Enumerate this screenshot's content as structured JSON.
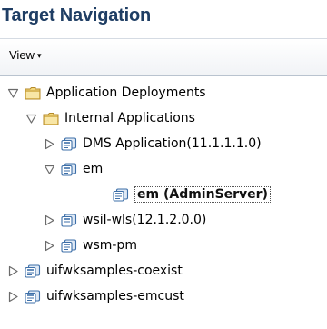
{
  "panel": {
    "title": "Target Navigation"
  },
  "toolbar": {
    "view_label": "View",
    "view_caret": "▾"
  },
  "tree": {
    "nodes": [
      {
        "label": "Application Deployments",
        "level": 0,
        "expander": "expanded",
        "icon": "folder-icon"
      },
      {
        "label": "Internal Applications",
        "level": 1,
        "expander": "expanded",
        "icon": "folder-icon"
      },
      {
        "label": "DMS Application(11.1.1.1.0)",
        "level": 2,
        "expander": "collapsed",
        "icon": "application-icon"
      },
      {
        "label": "em",
        "level": 2,
        "expander": "expanded",
        "icon": "application-icon"
      },
      {
        "label": "em (AdminServer)",
        "level": 3,
        "expander": "none",
        "icon": "application-icon",
        "selected": true
      },
      {
        "label": "wsil-wls(12.1.2.0.0)",
        "level": 2,
        "expander": "collapsed",
        "icon": "application-icon"
      },
      {
        "label": "wsm-pm",
        "level": 2,
        "expander": "collapsed",
        "icon": "application-icon"
      },
      {
        "label": "uifwksamples-coexist",
        "level": 1,
        "expander": "collapsed",
        "icon": "application-icon"
      },
      {
        "label": "uifwksamples-emcust",
        "level": 1,
        "expander": "collapsed",
        "icon": "application-icon"
      }
    ]
  },
  "colors": {
    "title": "#1f3e64",
    "folder_fill": "#f3d77a",
    "folder_stroke": "#b48a2a",
    "app_fill": "#dfe9f5",
    "app_stroke": "#3d6fa8",
    "twisty": "#6a6a6a"
  }
}
